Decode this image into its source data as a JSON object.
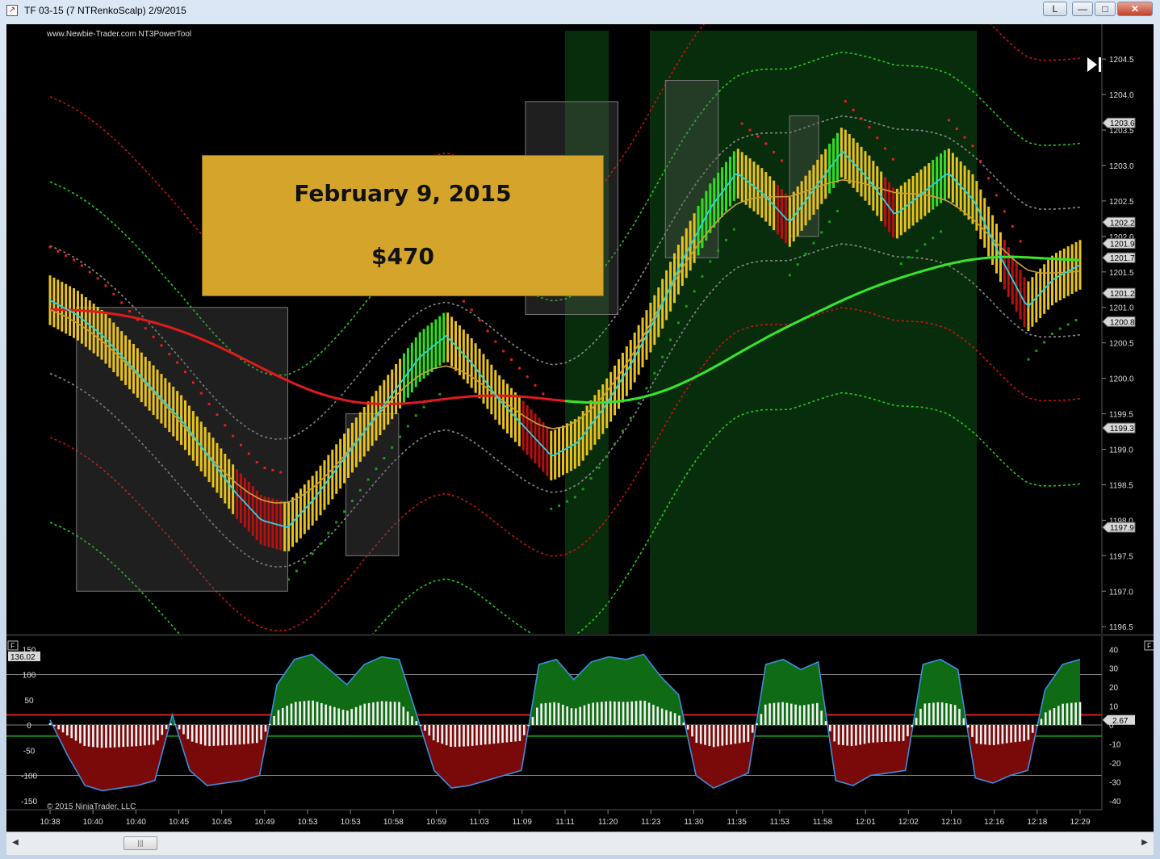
{
  "window": {
    "title": "TF 03-15 (7 NTRenkoScalp)  2/9/2015",
    "buttons": {
      "link": "L",
      "minimize": "—",
      "maximize": "□",
      "close": "✕"
    }
  },
  "chart": {
    "watermark": "www.Newbie-Trader.com NT3PowerTool",
    "copyright": "© 2015 NinjaTrader, LLC",
    "banner": {
      "date": "February 9, 2015",
      "amount": "$470"
    },
    "panel_flag": "F"
  },
  "chart_data": [
    {
      "type": "bar",
      "name": "price",
      "ylim": [
        1196.4,
        1204.9
      ],
      "y_ticks": [
        "1204.5",
        "1204.0",
        "1203.5",
        "1203.0",
        "1202.5",
        "1202.0",
        "1201.5",
        "1201.0",
        "1200.5",
        "1200.0",
        "1199.5",
        "1199.0",
        "1198.5",
        "1198.0",
        "1197.5",
        "1197.0",
        "1196.5"
      ],
      "price_markers": [
        {
          "label": "1203.6",
          "value": 1203.6
        },
        {
          "label": "1202.2",
          "value": 1202.2
        },
        {
          "label": "1201.9",
          "value": 1201.9
        },
        {
          "label": "1201.7",
          "value": 1201.7
        },
        {
          "label": "1201.2",
          "value": 1201.2
        },
        {
          "label": "1200.8",
          "value": 1200.8
        },
        {
          "label": "1199.3",
          "value": 1199.3
        },
        {
          "label": "1197.9",
          "value": 1197.9
        }
      ],
      "x_labels": [
        "10:38",
        "10:40",
        "10:40",
        "10:45",
        "10:45",
        "10:49",
        "10:53",
        "10:53",
        "10:58",
        "10:59",
        "11:03",
        "11:09",
        "11:11",
        "11:20",
        "11:23",
        "11:30",
        "11:35",
        "11:53",
        "11:58",
        "12:01",
        "12:02",
        "12:10",
        "12:16",
        "12:18",
        "12:29"
      ],
      "close_path": [
        1201.1,
        1200.9,
        1200.6,
        1200.2,
        1199.8,
        1199.4,
        1198.9,
        1198.4,
        1198.0,
        1197.9,
        1198.3,
        1198.8,
        1199.3,
        1199.8,
        1200.3,
        1200.6,
        1200.2,
        1199.7,
        1199.3,
        1198.9,
        1199.1,
        1199.6,
        1200.2,
        1200.9,
        1201.7,
        1202.4,
        1202.9,
        1202.6,
        1202.2,
        1202.7,
        1203.2,
        1202.8,
        1202.3,
        1202.6,
        1202.9,
        1202.5,
        1201.7,
        1201.0,
        1201.4,
        1201.6
      ]
    },
    {
      "type": "area",
      "name": "oscillator",
      "ylim": [
        -160,
        160
      ],
      "y_ticks_left": [
        "150",
        "100",
        "50",
        "0",
        "-50",
        "-100",
        "-150"
      ],
      "y_ticks_right": [
        "40",
        "30",
        "20",
        "10",
        "0",
        "-10",
        "-20",
        "-30",
        "-40"
      ],
      "current_left": "136.02",
      "current_right": "2.67",
      "values": [
        10,
        -60,
        -120,
        -130,
        -125,
        -120,
        -110,
        20,
        -90,
        -120,
        -115,
        -110,
        -100,
        80,
        130,
        140,
        110,
        80,
        120,
        135,
        130,
        20,
        -90,
        -125,
        -120,
        -110,
        -100,
        -90,
        120,
        130,
        90,
        125,
        135,
        130,
        140,
        95,
        60,
        -100,
        -125,
        -110,
        -95,
        120,
        130,
        110,
        125,
        -110,
        -120,
        -100,
        -95,
        -90,
        120,
        130,
        110,
        -105,
        -115,
        -100,
        -90,
        70,
        120,
        130
      ]
    }
  ]
}
